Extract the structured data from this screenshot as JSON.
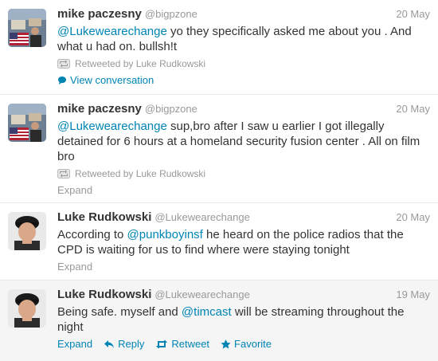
{
  "tweets": [
    {
      "fullname": "mike paczesny",
      "username": "@bigpzone",
      "time": "20 May",
      "mention": "@Lukewearechange",
      "text": " yo they specifically asked me about you . And what u had on. bullsh!t",
      "retweeted_by": "Retweeted by Luke Rudkowski",
      "action": "View conversation"
    },
    {
      "fullname": "mike paczesny",
      "username": "@bigpzone",
      "time": "20 May",
      "mention": "@Lukewearechange",
      "text": " sup,bro after I saw u earlier I got illegally detained for 6 hours at a homeland security fusion center . All on film bro",
      "retweeted_by": "Retweeted by Luke Rudkowski",
      "action": "Expand"
    },
    {
      "fullname": "Luke Rudkowski",
      "username": "@Lukewearechange",
      "time": "20 May",
      "text_before": "According to ",
      "mention": "@punkboyinsf",
      "text_after": " he heard on the police radios that the CPD is waiting for us to find where were staying tonight",
      "action": "Expand"
    },
    {
      "fullname": "Luke Rudkowski",
      "username": "@Lukewearechange",
      "time": "19 May",
      "text_before": "Being safe. myself and ",
      "mention": "@timcast",
      "text_after": " will be streaming throughout the night",
      "actions": {
        "expand": "Expand",
        "reply": "Reply",
        "retweet": "Retweet",
        "favorite": "Favorite"
      }
    }
  ]
}
